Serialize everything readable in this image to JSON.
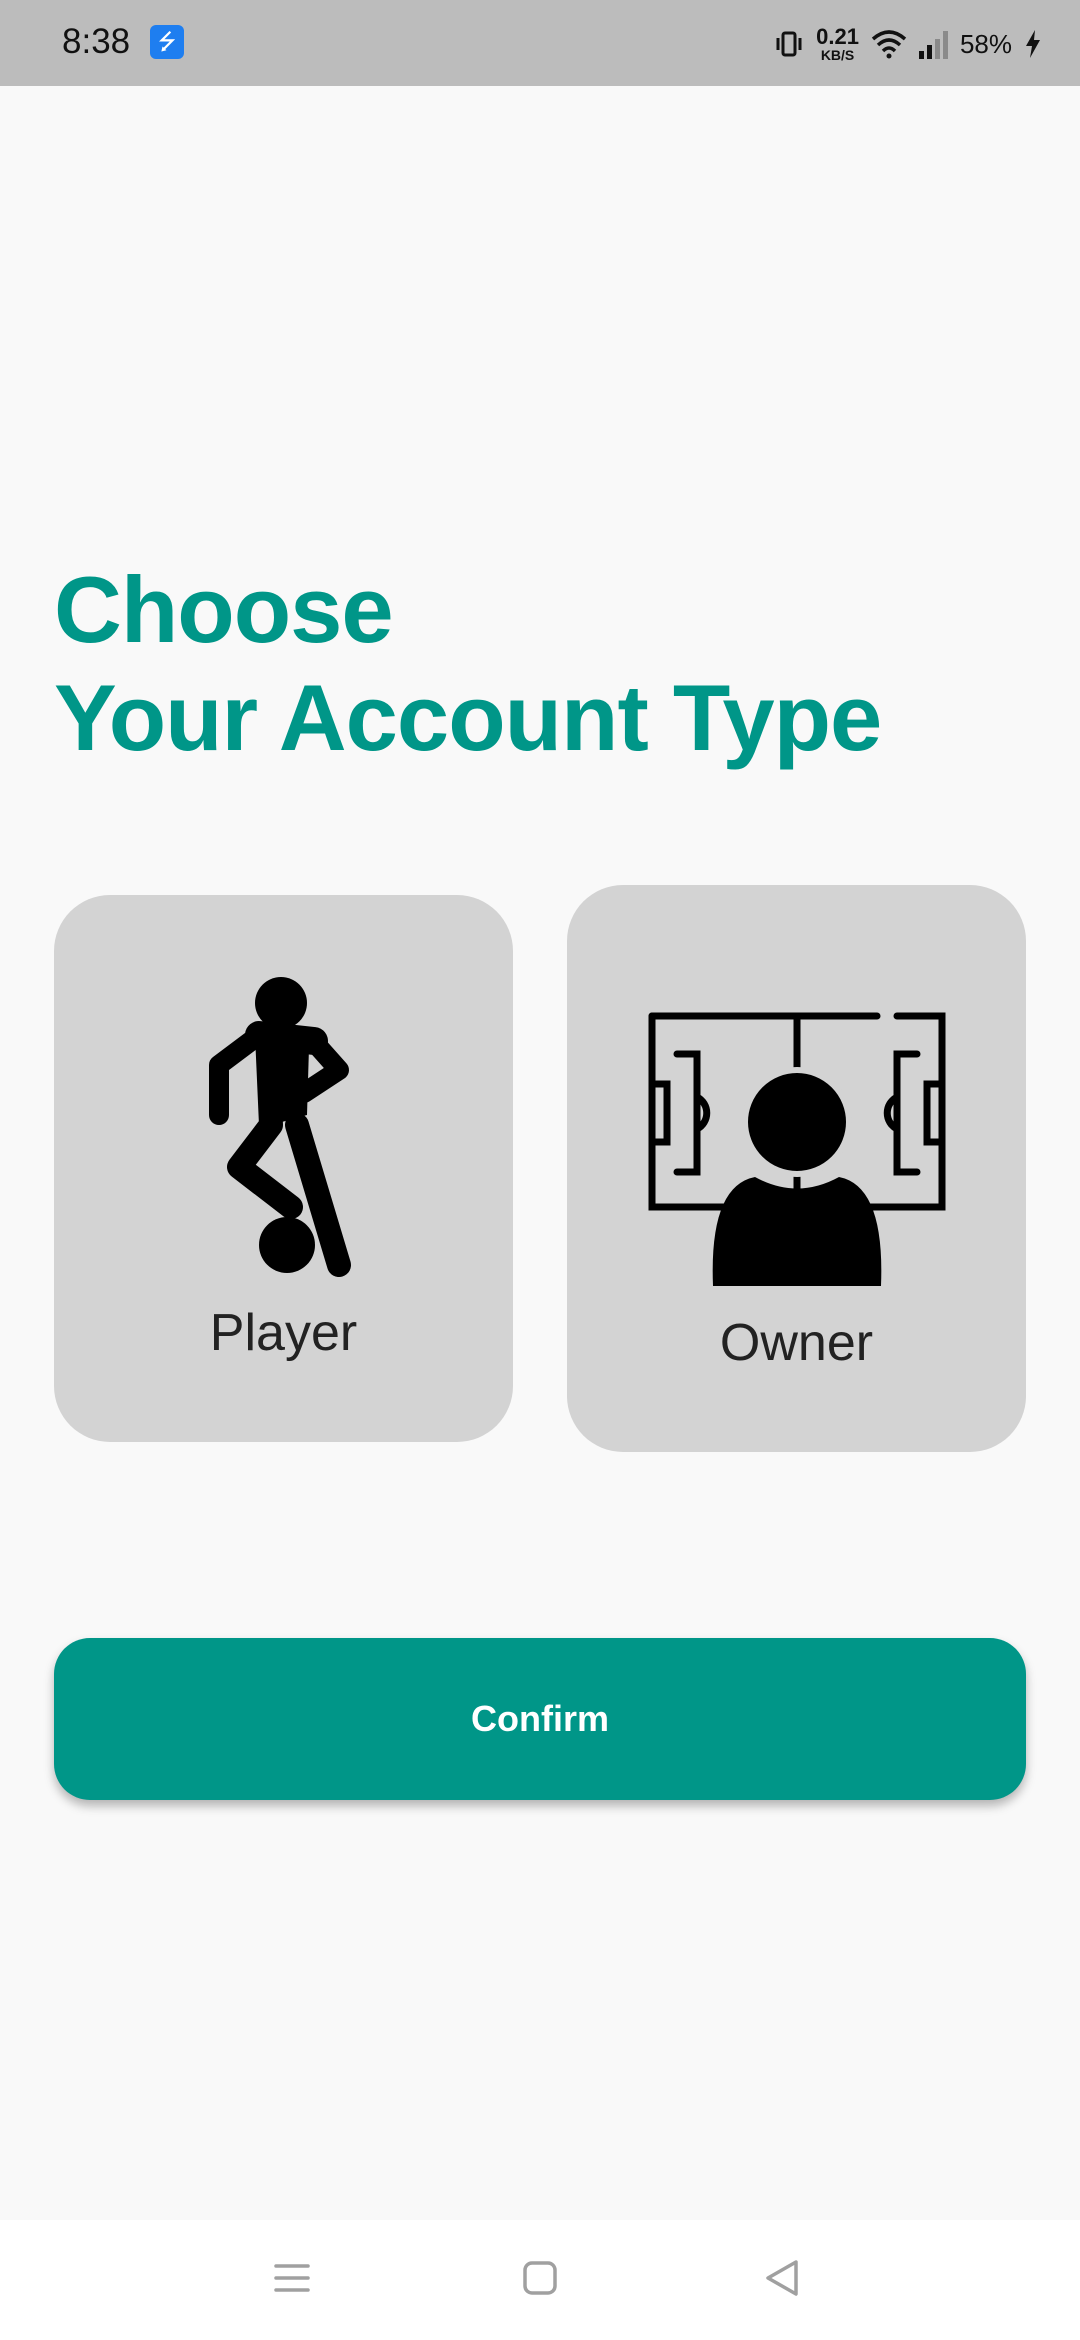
{
  "status_bar": {
    "time": "8:38",
    "usb_icon": "usb-icon",
    "net_speed_value": "0.21",
    "net_speed_unit": "KB/S",
    "battery": "58%"
  },
  "heading": {
    "line1": "Choose",
    "line2": "Your Account Type"
  },
  "account_types": [
    {
      "label": "Player",
      "icon": "soccer-player-icon"
    },
    {
      "label": "Owner",
      "icon": "field-owner-icon"
    }
  ],
  "confirm_label": "Confirm",
  "colors": {
    "accent": "#009688",
    "card_background": "#d3d3d3",
    "page_background": "#f9f9f9",
    "status_bar": "#bcbcbc"
  }
}
